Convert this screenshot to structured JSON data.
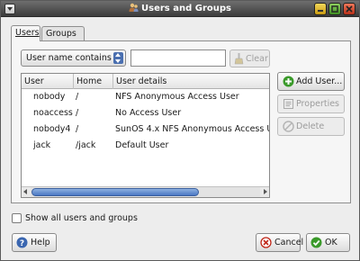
{
  "window": {
    "title": "Users and Groups"
  },
  "tabs": [
    {
      "label": "Users",
      "active": true
    },
    {
      "label": "Groups",
      "active": false
    }
  ],
  "filter": {
    "selected_option": "User name contains",
    "input_value": "",
    "clear_label": "Clear"
  },
  "table": {
    "columns": [
      "User",
      "Home",
      "User details"
    ],
    "rows": [
      {
        "user": "nobody",
        "home": "/",
        "details": "NFS Anonymous Access User"
      },
      {
        "user": "noaccess",
        "home": "/",
        "details": "No Access User"
      },
      {
        "user": "nobody4",
        "home": "/",
        "details": "SunOS 4.x NFS Anonymous Access User"
      },
      {
        "user": "jack",
        "home": "/jack",
        "details": "Default User"
      }
    ]
  },
  "actions": {
    "add_label": "Add User...",
    "properties_label": "Properties",
    "delete_label": "Delete"
  },
  "show_all": {
    "label": "Show all users and groups",
    "checked": false
  },
  "footer": {
    "help_label": "Help",
    "cancel_label": "Cancel",
    "ok_label": "OK"
  },
  "icons": {
    "title": "users-icon",
    "clear": "broom-icon",
    "add": "add-icon",
    "properties": "properties-icon",
    "delete": "delete-icon",
    "help": "help-icon",
    "cancel": "cancel-icon",
    "ok": "ok-icon"
  },
  "colors": {
    "titlebar": "#3c3c3c",
    "accent": "#4a78c4",
    "add": "#3a9a2a",
    "cancel": "#c0281a"
  }
}
